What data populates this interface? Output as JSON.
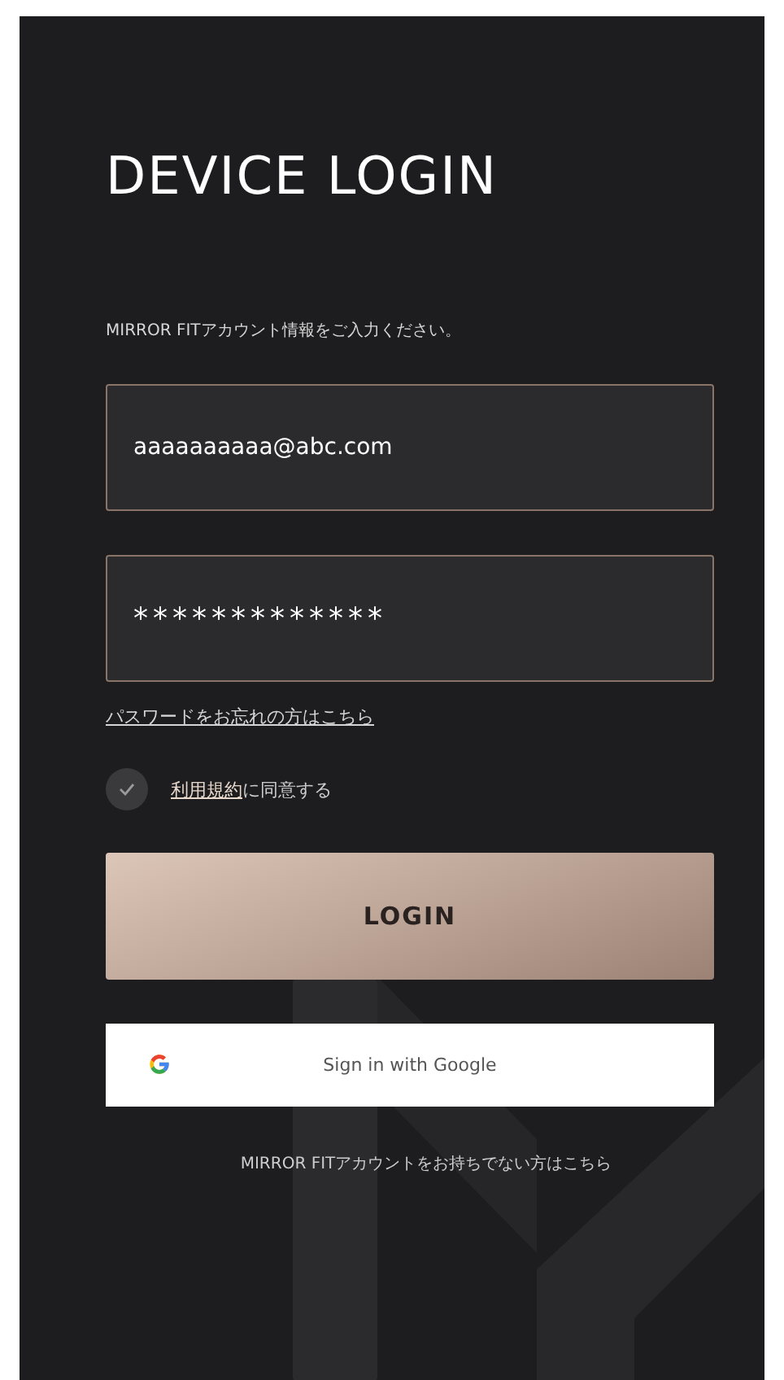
{
  "title": "DEVICE LOGIN",
  "subtitle": "MIRROR FITアカウント情報をご入力ください。",
  "email": {
    "value": "aaaaaaaaaa@abc.com"
  },
  "password": {
    "value": "*************"
  },
  "forgot_link": "パスワードをお忘れの方はこちら",
  "terms": {
    "checked": true,
    "link": "利用規約",
    "text": "に同意する"
  },
  "login_button": "LOGIN",
  "google_button": "Sign in with Google",
  "signup_link": "MIRROR FITアカウントをお持ちでない方はこちら"
}
